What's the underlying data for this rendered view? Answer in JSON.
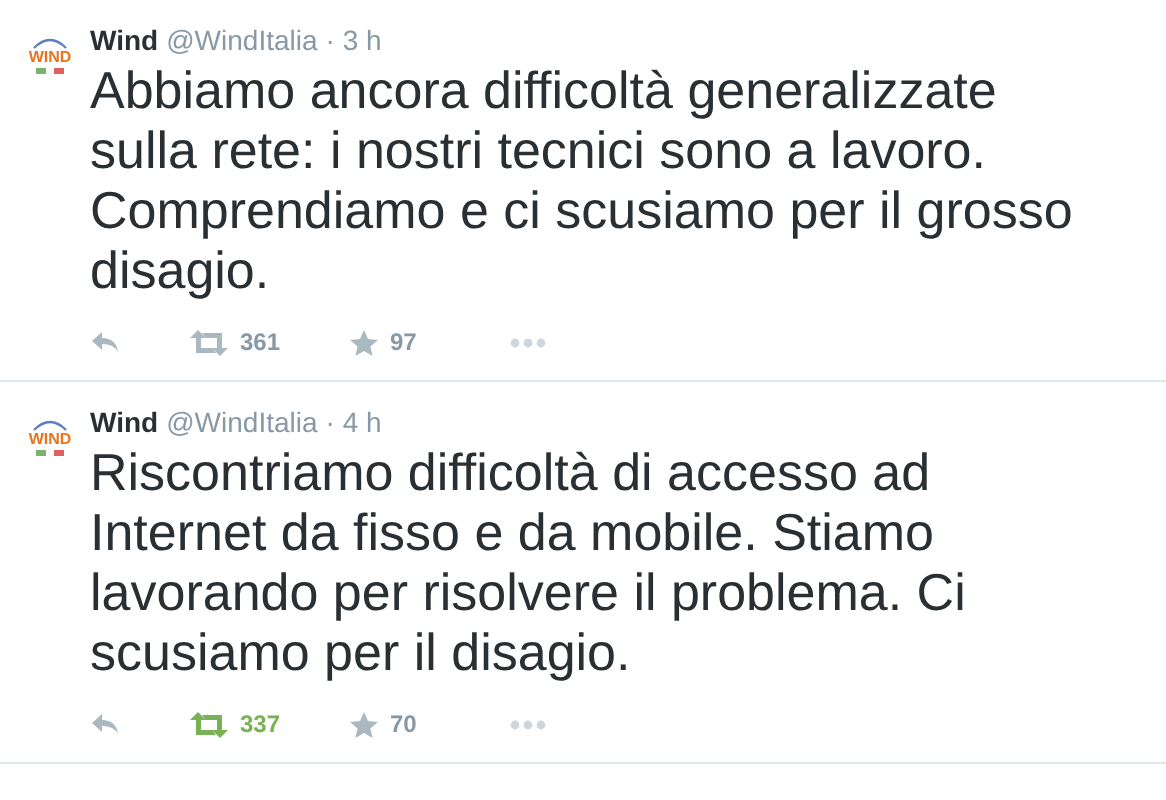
{
  "tweets": [
    {
      "avatar_text": "WIND",
      "name": "Wind",
      "handle": "@WindItalia",
      "time": "· 3 h",
      "text": "Abbiamo ancora difficoltà generalizzate sulla rete: i nostri tecnici sono a lavoro. Comprendiamo e ci scusiamo per il grosso disagio.",
      "retweets": "361",
      "favorites": "97",
      "retweeted": false
    },
    {
      "avatar_text": "WIND",
      "name": "Wind",
      "handle": "@WindItalia",
      "time": "· 4 h",
      "text": "Riscontriamo difficoltà di accesso ad Internet da fisso e da mobile. Stiamo lavorando per risolvere il problema. Ci scusiamo per il disagio.",
      "retweets": "337",
      "favorites": "70",
      "retweeted": true
    }
  ]
}
